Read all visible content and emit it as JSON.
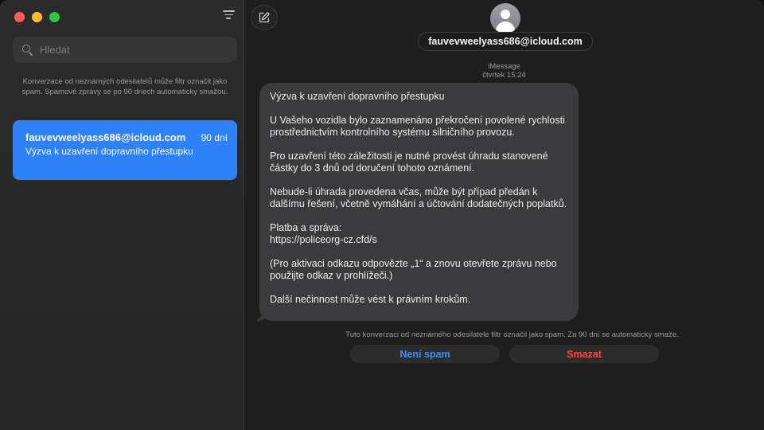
{
  "sidebar": {
    "search_placeholder": "Hledat",
    "spam_note": "Konverzace od neznámých odesilatelů může filtr označit jako spam. Spamové zprávy se po 90 dnech automaticky smažou.",
    "conversations": [
      {
        "sender": "fauvevweelyass686@icloud.com",
        "date": "90 dní",
        "preview": "Výzva k uzavření dopravního přestupku",
        "selected": true
      }
    ]
  },
  "header": {
    "contact": "fauvevweelyass686@icloud.com"
  },
  "thread": {
    "service": "iMessage",
    "timestamp": "čtvrtek 15:24",
    "message_paragraphs": [
      "Výzva k uzavření dopravního přestupku",
      "U Vašeho vozidla bylo zaznamenáno překročení povolené rychlosti prostřednictvím kontrolního systému silničního provozu.",
      "Pro uzavření této záležitosti je nutné provést úhradu stanovené částky do 3 dnů od doručení tohoto oznámení.",
      "Nebude-li úhrada provedena včas, může být případ předán k dalšímu řešení, včetně vymáhání a účtování dodatečných poplatků.",
      "Platba a správa:\nhttps://policeorg-cz.cfd/s",
      "(Pro aktivaci odkazu odpovězte „1“ a znovu otevřete zprávu nebo použijte odkaz v prohlížeči.)",
      "Další nečinnost může vést k právním krokům."
    ],
    "filter_note": "Tuto konverzaci od neznámého odesilatele filtr označil jako spam. Za 90 dní se automaticky smaže.",
    "not_spam_label": "Není spam",
    "delete_label": "Smazat"
  },
  "colors": {
    "accent": "#2f81f7",
    "link": "#3d8ef5",
    "destructive": "#ff453a",
    "bubble": "#3b3b3d"
  },
  "icons": [
    "close-window-icon",
    "minimize-window-icon",
    "maximize-window-icon",
    "filter-icon",
    "search-icon",
    "compose-icon",
    "contact-avatar-icon"
  ]
}
